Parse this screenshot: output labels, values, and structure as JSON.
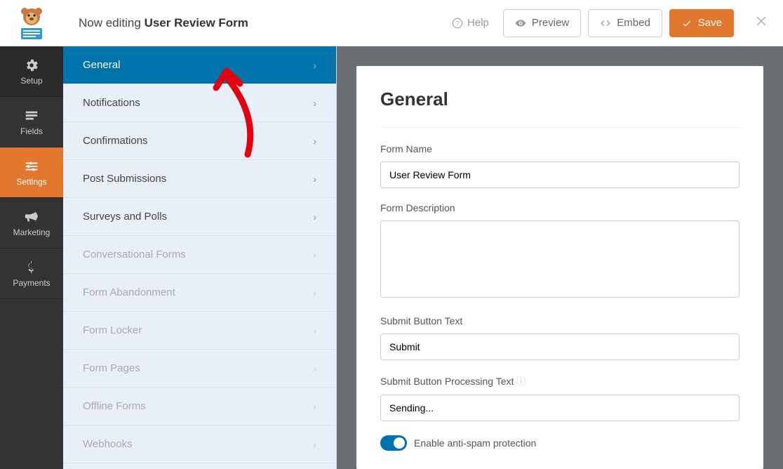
{
  "header": {
    "prefix": "Now editing",
    "formName": "User Review Form",
    "help": "Help",
    "preview": "Preview",
    "embed": "Embed",
    "save": "Save"
  },
  "iconbar": {
    "setup": "Setup",
    "fields": "Fields",
    "settings": "Settings",
    "marketing": "Marketing",
    "payments": "Payments"
  },
  "settingsMenu": {
    "general": "General",
    "notifications": "Notifications",
    "confirmations": "Confirmations",
    "postSubmissions": "Post Submissions",
    "surveysPolls": "Surveys and Polls",
    "conversational": "Conversational Forms",
    "abandonment": "Form Abandonment",
    "locker": "Form Locker",
    "pages": "Form Pages",
    "offline": "Offline Forms",
    "webhooks": "Webhooks"
  },
  "panel": {
    "heading": "General",
    "formNameLabel": "Form Name",
    "formNameValue": "User Review Form",
    "formDescLabel": "Form Description",
    "formDescValue": "",
    "submitTextLabel": "Submit Button Text",
    "submitTextValue": "Submit",
    "processingLabel": "Submit Button Processing Text",
    "processingValue": "Sending...",
    "antispam": "Enable anti-spam protection"
  }
}
